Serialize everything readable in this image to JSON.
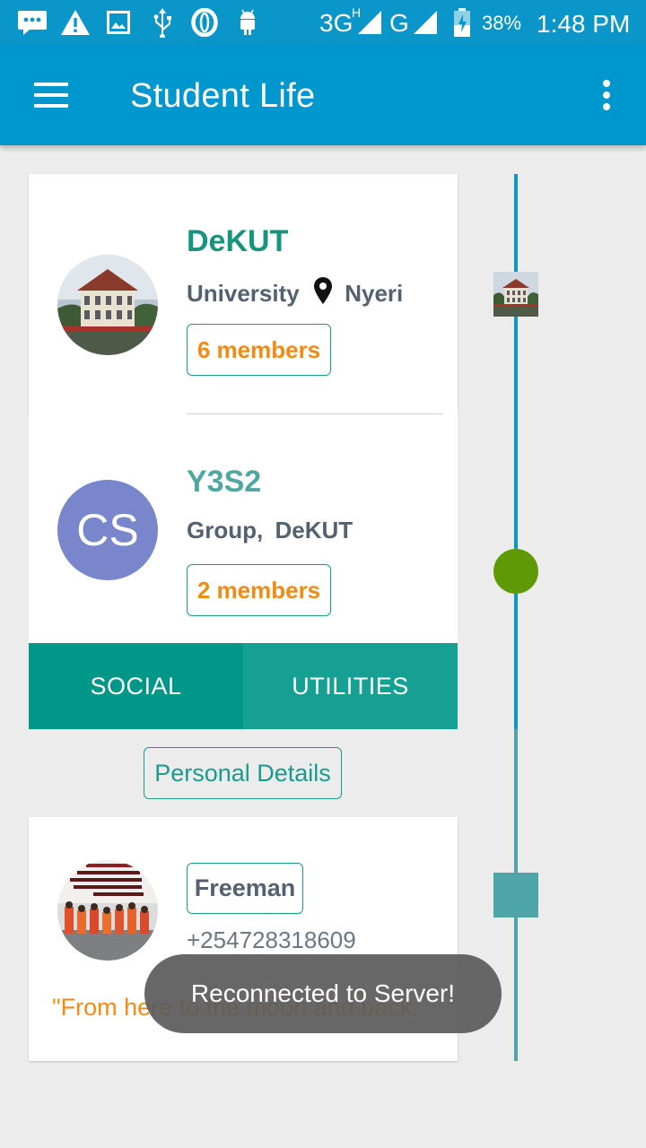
{
  "status_bar": {
    "network_3g": "3G",
    "network_h": "H",
    "network_g": "G",
    "battery_percent": "38%",
    "time": "1:48 PM",
    "icons": [
      "messenger-icon",
      "warning-icon",
      "image-icon",
      "usb-icon",
      "opera-icon",
      "android-icon",
      "signal-3g-icon",
      "signal-g-icon",
      "battery-icon"
    ]
  },
  "app_bar": {
    "title": "Student Life",
    "menu_icon": "hamburger-menu-icon",
    "overflow_icon": "more-vert-icon"
  },
  "cards": {
    "university": {
      "name": "DeKUT",
      "type": "University",
      "location": "Nyeri",
      "members": "6 members",
      "name_color": "#15957e"
    },
    "group": {
      "avatar_initials": "CS",
      "name": "Y3S2",
      "type": "Group,",
      "parent": "DeKUT",
      "members": "2 members",
      "avatar_color": "#7986cb",
      "name_color": "#4fa7a0"
    }
  },
  "tabs": [
    {
      "label": "SOCIAL",
      "color": "#009688"
    },
    {
      "label": "UTILITIES",
      "color": "#16a093"
    }
  ],
  "personal_details_label": "Personal Details",
  "profile": {
    "name": "Freeman",
    "phone": "+254728318609",
    "quote": "\"From here to the moon and back."
  },
  "timeline": {
    "line_color_top": "#0a96c8",
    "line_color_bottom": "#4ea5a8",
    "node_circle_color": "#5f9a06",
    "node_square_color": "#4ea5a8"
  },
  "toast": "Reconnected to Server!",
  "colors": {
    "primary": "#0096ce",
    "accent": "#f58a12",
    "teal": "#199c8c"
  }
}
